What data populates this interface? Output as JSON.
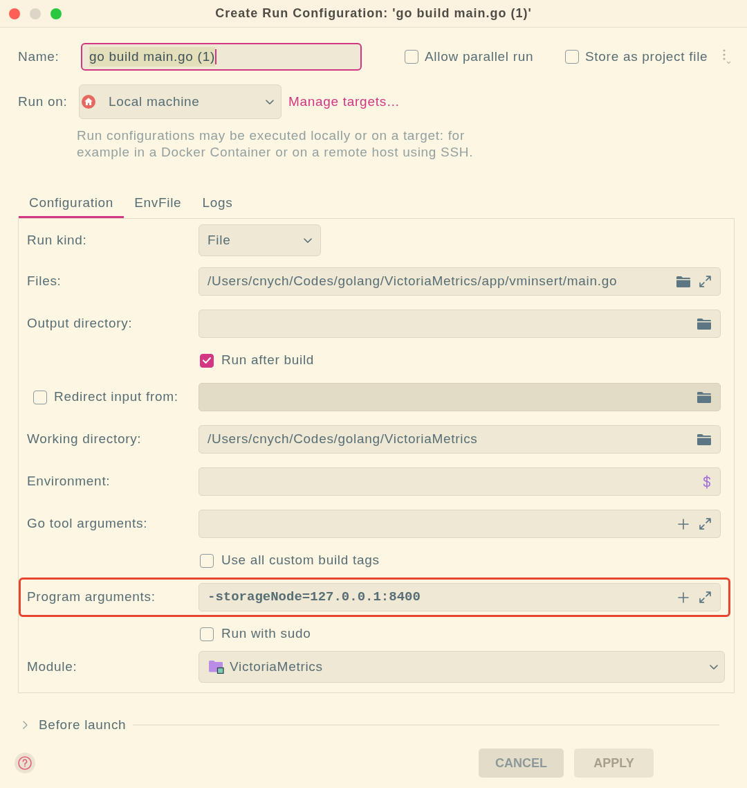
{
  "window": {
    "title": "Create Run Configuration: 'go build main.go (1)'"
  },
  "name": {
    "label": "Name:",
    "value": "go build main.go (1)",
    "focused": true,
    "text_selected": true
  },
  "options": [
    {
      "label": "Allow parallel run",
      "checked": false
    },
    {
      "label": "Store as project file",
      "checked": false
    }
  ],
  "run_on": {
    "label": "Run on:",
    "value": "Local machine",
    "link": "Manage targets…",
    "hint": "Run configurations may be executed locally or on a target: for example in a Docker Container or on a remote host using SSH."
  },
  "tabs": [
    {
      "label": "Configuration",
      "selected": true
    },
    {
      "label": "EnvFile",
      "selected": false
    },
    {
      "label": "Logs",
      "selected": false
    }
  ],
  "rows": [
    {
      "kind": "dropdown",
      "label": "Run kind:",
      "value": "File",
      "highlighted": false
    },
    {
      "kind": "file_field",
      "label": "Files:",
      "value": "/Users/cnych/Codes/golang/VictoriaMetrics/app/vminsert/main.go",
      "highlighted": false
    },
    {
      "kind": "directory_field",
      "label": "Output directory:",
      "highlighted": false
    },
    {
      "kind": "checkbox",
      "label": "Run after build",
      "checked": true,
      "highlighted": false
    },
    {
      "kind": "checkbox_directory",
      "label": "Redirect input from:",
      "checked": false,
      "highlighted": false
    },
    {
      "kind": "directory_field",
      "label": "Working directory:",
      "value": "/Users/cnych/Codes/golang/VictoriaMetrics",
      "highlighted": false
    },
    {
      "kind": "env_field",
      "label": "Environment:",
      "highlighted": false
    },
    {
      "kind": "args_field",
      "label": "Go tool arguments:",
      "highlighted": false
    },
    {
      "kind": "checkbox",
      "label": "Use all custom build tags",
      "checked": false,
      "highlighted": false
    },
    {
      "kind": "args_field",
      "label": "Program arguments:",
      "value": "-storageNode=127.0.0.1:8400",
      "highlighted": true
    },
    {
      "kind": "checkbox",
      "label": "Run with sudo",
      "checked": false,
      "highlighted": false
    },
    {
      "kind": "module_dropdown",
      "label": "Module:",
      "value": "VictoriaMetrics",
      "highlighted": false
    }
  ],
  "before_launch": {
    "label": "Before launch",
    "expanded": false
  },
  "buttons": [
    {
      "label": "CANCEL",
      "disabled": false
    },
    {
      "label": "APPLY",
      "disabled": true
    }
  ]
}
